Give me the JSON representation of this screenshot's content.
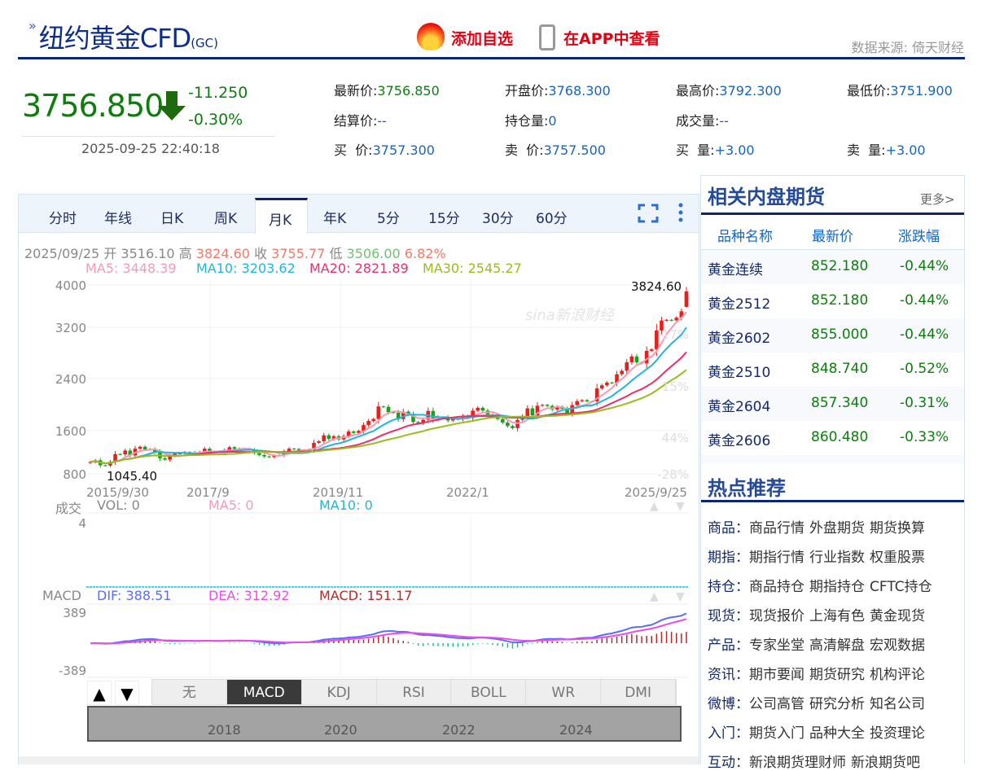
{
  "header": {
    "title": "纽约黄金CFD",
    "code": "(GC)",
    "add_watch": "添加自选",
    "view_app": "在APP中查看",
    "source": "数据来源: 倚天财经"
  },
  "quote": {
    "price": "3756.850",
    "change": "-11.250",
    "change_pct": "-0.30%",
    "time": "2025-09-25 22:40:18",
    "fields": [
      {
        "label": "最新价:",
        "value": "3756.850",
        "cls": "g"
      },
      {
        "label": "开盘价:",
        "value": "3768.300",
        "cls": "v"
      },
      {
        "label": "最高价:",
        "value": "3792.300",
        "cls": "v"
      },
      {
        "label": "最低价:",
        "value": "3751.900",
        "cls": "v"
      },
      {
        "label": "结算价:",
        "value": "--",
        "cls": "v"
      },
      {
        "label": "持仓量:",
        "value": "0",
        "cls": "v"
      },
      {
        "label": "成交量:",
        "value": "--",
        "cls": "v"
      },
      {
        "label": "",
        "value": "",
        "cls": "v"
      },
      {
        "label": "买  价:",
        "value": "3757.300",
        "cls": "v"
      },
      {
        "label": "卖  价:",
        "value": "3757.500",
        "cls": "v"
      },
      {
        "label": "买  量:",
        "value": "+3.00",
        "cls": "v"
      },
      {
        "label": "卖  量:",
        "value": "+3.00",
        "cls": "v"
      }
    ]
  },
  "tabs": [
    "分时",
    "年线",
    "日K",
    "周K",
    "月K",
    "年K",
    "5分",
    "15分",
    "30分",
    "60分"
  ],
  "active_tab": "月K",
  "ohlc": {
    "date": "2025/09/25",
    "open_l": "开",
    "open": "3516.10",
    "high_l": "高",
    "high": "3824.60",
    "close_l": "收",
    "close": "3755.77",
    "low_l": "低",
    "low": "3506.00",
    "pct": "6.82%"
  },
  "ma": {
    "ma5": "MA5: 3448.39",
    "ma10": "MA10: 3203.62",
    "ma20": "MA20: 2821.89",
    "ma30": "MA30: 2545.27"
  },
  "colors": {
    "up": "#e8201c",
    "down": "#17a317",
    "ma5": "#f59ab5",
    "ma10": "#1eb7dc",
    "ma20": "#e8306c",
    "ma30": "#98bd1c",
    "dif": "#5b6cf5",
    "dea": "#e84de8"
  },
  "chart_data": {
    "type": "candlestick",
    "y_ticks": [
      "4000",
      "3200",
      "2400",
      "1600",
      "800"
    ],
    "ylim": [
      800,
      4000
    ],
    "right_ticks": [
      "17%",
      "15%",
      "44%",
      "-28%"
    ],
    "x_ticks": [
      "2015/9/30",
      "2017/9",
      "2019/11",
      "2022/1",
      "2025/9/25"
    ],
    "max_label": "3824.60",
    "min_label": "1045.40",
    "watermark": "sina新浪财经",
    "closes": [
      1115,
      1142,
      1064,
      1061,
      1118,
      1238,
      1233,
      1293,
      1217,
      1322,
      1351,
      1309,
      1317,
      1273,
      1173,
      1152,
      1211,
      1249,
      1249,
      1269,
      1268,
      1242,
      1270,
      1322,
      1280,
      1271,
      1275,
      1303,
      1345,
      1318,
      1325,
      1316,
      1305,
      1253,
      1224,
      1202,
      1192,
      1215,
      1222,
      1282,
      1321,
      1316,
      1298,
      1284,
      1305,
      1413,
      1437,
      1529,
      1472,
      1514,
      1464,
      1517,
      1587,
      1566,
      1596,
      1686,
      1751,
      1781,
      1975,
      1968,
      1886,
      1879,
      1780,
      1895,
      1850,
      1734,
      1715,
      1769,
      1906,
      1770,
      1814,
      1813,
      1757,
      1783,
      1774,
      1829,
      1797,
      1909,
      1954,
      1911,
      1848,
      1817,
      1781,
      1726,
      1672,
      1640,
      1768,
      1826,
      1945,
      1837,
      1986,
      1999,
      1982,
      1929,
      1970,
      1940,
      1871,
      1996,
      2057,
      2072,
      2053,
      2054,
      2254,
      2302,
      2345,
      2339,
      2473,
      2527,
      2659,
      2749,
      2657,
      2641,
      2835,
      2858,
      3150,
      3305,
      3315,
      3307,
      3348,
      3448,
      3755.77
    ],
    "last_open": 3516.1,
    "last_high": 3824.6,
    "last_low": 3506.0
  },
  "volume": {
    "label": "成交",
    "vol": "VOL: 0",
    "ma5": "MA5: 0",
    "ma10": "MA10: 0",
    "tick": "4"
  },
  "macd": {
    "label": "MACD",
    "dif": "DIF: 388.51",
    "dea": "DEA: 312.92",
    "macd": "MACD: 151.17",
    "top": "389",
    "bottom": "-389"
  },
  "indicators": [
    "无",
    "MACD",
    "KDJ",
    "RSI",
    "BOLL",
    "WR",
    "DMI"
  ],
  "active_indicator": "MACD",
  "navigator_years": [
    "2018",
    "2020",
    "2022",
    "2024"
  ],
  "related": {
    "title": "相关内盘期货",
    "more": "更多>",
    "headers": [
      "品种名称",
      "最新价",
      "涨跌幅"
    ],
    "rows": [
      [
        "黄金连续",
        "852.180",
        "-0.44%"
      ],
      [
        "黄金2512",
        "852.180",
        "-0.44%"
      ],
      [
        "黄金2602",
        "855.000",
        "-0.44%"
      ],
      [
        "黄金2510",
        "848.740",
        "-0.52%"
      ],
      [
        "黄金2604",
        "857.340",
        "-0.31%"
      ],
      [
        "黄金2606",
        "860.480",
        "-0.33%"
      ]
    ]
  },
  "hot": {
    "title": "热点推荐",
    "rows": [
      {
        "cat": "商品：",
        "links": [
          "商品行情",
          "外盘期货",
          "期货换算"
        ]
      },
      {
        "cat": "期指：",
        "links": [
          "期指行情",
          "行业指数",
          "权重股票"
        ]
      },
      {
        "cat": "持仓：",
        "links": [
          "商品持仓",
          "期指持仓",
          "CFTC持仓"
        ]
      },
      {
        "cat": "现货：",
        "links": [
          "现货报价",
          "上海有色",
          "黄金现货"
        ]
      },
      {
        "cat": "产品：",
        "links": [
          "专家坐堂",
          "高清解盘",
          "宏观数据"
        ]
      },
      {
        "cat": "资讯：",
        "links": [
          "期市要闻",
          "期货研究",
          "机构评论"
        ]
      },
      {
        "cat": "微博：",
        "links": [
          "公司高管",
          "研究分析",
          "知名公司"
        ]
      },
      {
        "cat": "入门：",
        "links": [
          "期货入门",
          "品种大全",
          "投资理论"
        ]
      },
      {
        "cat": "互动：",
        "links": [
          "新浪期货理财师",
          "新浪期货吧"
        ]
      }
    ]
  }
}
